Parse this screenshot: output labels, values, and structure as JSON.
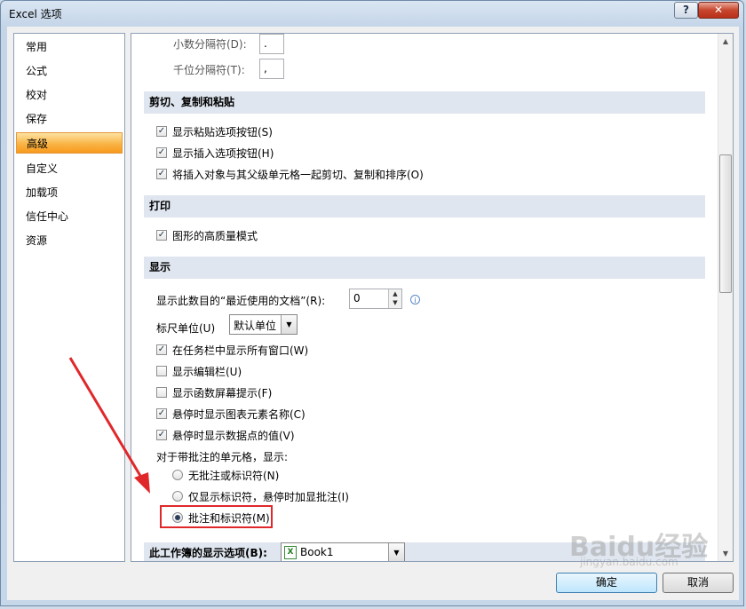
{
  "window": {
    "title": "Excel 选项",
    "help_label": "?",
    "close_label": "✕"
  },
  "nav": {
    "items": [
      "常用",
      "公式",
      "校对",
      "保存",
      "高级",
      "自定义",
      "加载项",
      "信任中心",
      "资源"
    ],
    "selected_index": 4
  },
  "content": {
    "top": {
      "decimal_sep_label": "小数分隔符(D):",
      "decimal_sep_value": ".",
      "thousands_sep_label": "千位分隔符(T):",
      "thousands_sep_value": ","
    },
    "cut_copy_paste": {
      "header": "剪切、复制和粘贴",
      "options": [
        {
          "label": "显示粘贴选项按钮(S)",
          "checked": true
        },
        {
          "label": "显示插入选项按钮(H)",
          "checked": true
        },
        {
          "label": "将插入对象与其父级单元格一起剪切、复制和排序(O)",
          "checked": true
        }
      ]
    },
    "print": {
      "header": "打印",
      "options": [
        {
          "label": "图形的高质量模式",
          "checked": true
        }
      ]
    },
    "display": {
      "header": "显示",
      "recent_docs_label": "显示此数目的“最近使用的文档”(R):",
      "recent_docs_value": "0",
      "info_icon": "i",
      "ruler_label": "标尺单位(U)",
      "ruler_value": "默认单位",
      "options": [
        {
          "label": "在任务栏中显示所有窗口(W)",
          "checked": true
        },
        {
          "label": "显示编辑栏(U)",
          "checked": false
        },
        {
          "label": "显示函数屏幕提示(F)",
          "checked": false
        },
        {
          "label": "悬停时显示图表元素名称(C)",
          "checked": true
        },
        {
          "label": "悬停时显示数据点的值(V)",
          "checked": true
        }
      ],
      "comments_label": "对于带批注的单元格，显示:",
      "comment_options": [
        {
          "label": "无批注或标识符(N)",
          "selected": false
        },
        {
          "label": "仅显示标识符，悬停时加显批注(I)",
          "selected": false
        },
        {
          "label": "批注和标识符(M)",
          "selected": true
        }
      ]
    },
    "workbook": {
      "header": "此工作簿的显示选项(B):",
      "workbook_value": "Book1",
      "file_icon": "X"
    }
  },
  "buttons": {
    "ok": "确定",
    "cancel": "取消"
  },
  "watermark": {
    "logo": "Baidu经验",
    "url": "jingyan.baidu.com"
  },
  "colors": {
    "highlight": "#e0282b",
    "selected_nav": "#f9b446",
    "section_bg": "#dfe6ef"
  }
}
